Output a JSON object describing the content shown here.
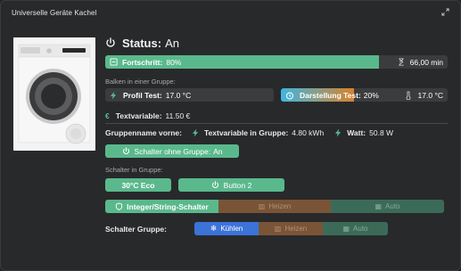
{
  "card": {
    "title": "Universelle Geräte Kachel"
  },
  "status": {
    "label": "Status:",
    "value": "An"
  },
  "progress": {
    "label": "Fortschritt:",
    "value_text": "80%",
    "fraction": 0.8,
    "time": "66,00 min"
  },
  "groups": {
    "bars_label": "Balken in einer Gruppe:",
    "profil": {
      "label": "Profil Test:",
      "value": "17.0 °C"
    },
    "darstellung": {
      "label": "Darstellung Test:",
      "value": "20%",
      "temp": "17.0 °C",
      "fraction": 0.2
    },
    "textvariable": {
      "label": "Textvariable:",
      "value": "11.50 €"
    }
  },
  "group_front": {
    "label": "Gruppenname vorne:",
    "text_label": "Textvariable in Gruppe:",
    "text_value": "4.80 kWh",
    "watt_label": "Watt:",
    "watt_value": "50.8 W"
  },
  "switch_no_group": {
    "label": "Schalter ohne Gruppe:",
    "value": "An"
  },
  "switch_group": {
    "label": "Schalter in Gruppe:",
    "eco": "30°C Eco",
    "button2": "Button 2"
  },
  "integer_switch": {
    "label": "Integer/String-Schalter",
    "heizen": "Heizen",
    "auto": "Auto"
  },
  "switch_group_row": {
    "label": "Schalter Gruppe:",
    "kuehlen": "Kühlen",
    "heizen": "Heizen",
    "auto": "Auto"
  },
  "colors": {
    "green": "#5ab98c",
    "progress_green": "#5ab98c",
    "orange": "#d9822b",
    "blue": "#3b73d9",
    "blue_start": "#3fb6e0"
  }
}
